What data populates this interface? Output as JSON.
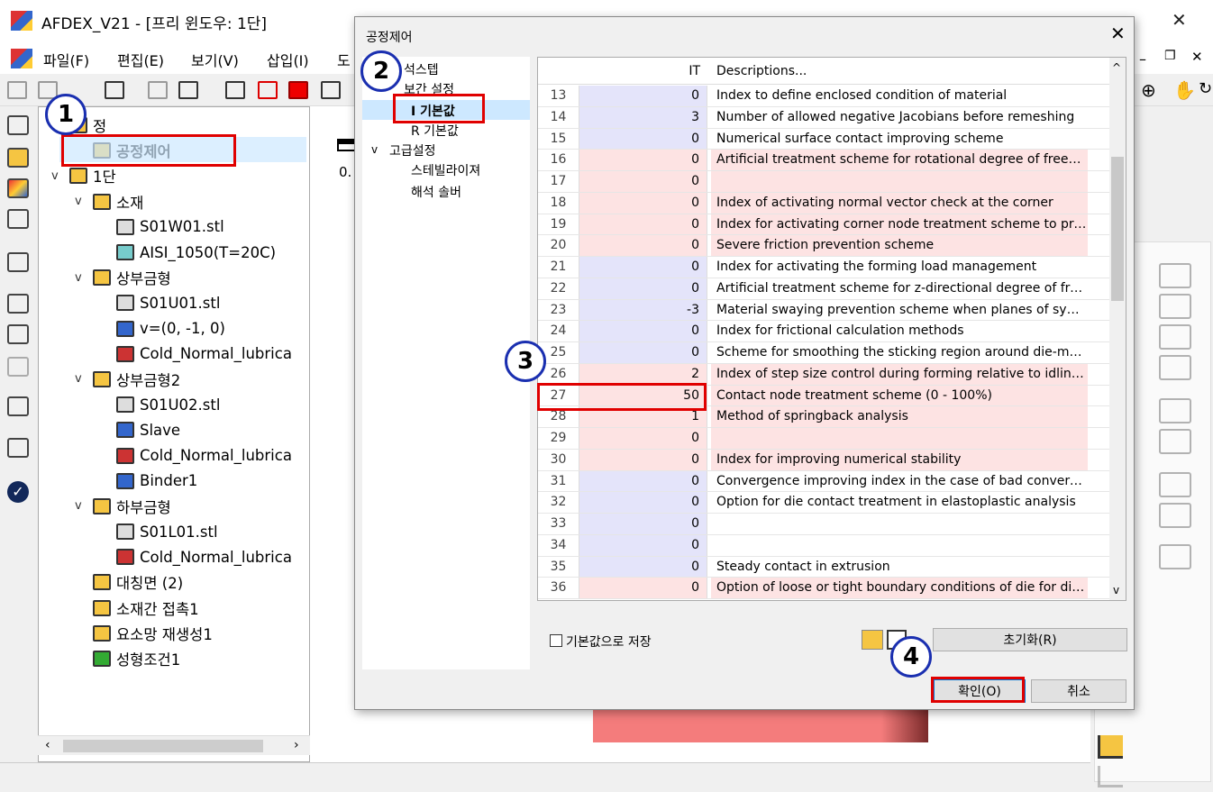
{
  "app": {
    "title": "AFDEX_V21 - [프리 윈도우: 1단]"
  },
  "menus": [
    "파일(F)",
    "편집(E)",
    "보기(V)",
    "삽입(I)",
    "도"
  ],
  "tree": {
    "items": [
      {
        "label": "정",
        "indent": 0,
        "exp": ""
      },
      {
        "label": "공정제어",
        "indent": 1,
        "exp": ""
      },
      {
        "label": "1단",
        "indent": 0,
        "exp": "v"
      },
      {
        "label": "소재",
        "indent": 1,
        "exp": "v"
      },
      {
        "label": "S01W01.stl",
        "indent": 2,
        "exp": ""
      },
      {
        "label": "AISI_1050(T=20C)",
        "indent": 2,
        "exp": ""
      },
      {
        "label": "상부금형",
        "indent": 1,
        "exp": "v"
      },
      {
        "label": "S01U01.stl",
        "indent": 2,
        "exp": ""
      },
      {
        "label": "v=(0, -1, 0)",
        "indent": 2,
        "exp": ""
      },
      {
        "label": "Cold_Normal_lubrica",
        "indent": 2,
        "exp": ""
      },
      {
        "label": "상부금형2",
        "indent": 1,
        "exp": "v"
      },
      {
        "label": "S01U02.stl",
        "indent": 2,
        "exp": ""
      },
      {
        "label": "Slave",
        "indent": 2,
        "exp": ""
      },
      {
        "label": "Cold_Normal_lubrica",
        "indent": 2,
        "exp": ""
      },
      {
        "label": "Binder1",
        "indent": 2,
        "exp": ""
      },
      {
        "label": "하부금형",
        "indent": 1,
        "exp": "v"
      },
      {
        "label": "S01L01.stl",
        "indent": 2,
        "exp": ""
      },
      {
        "label": "Cold_Normal_lubrica",
        "indent": 2,
        "exp": ""
      },
      {
        "label": "대칭면 (2)",
        "indent": 1,
        "exp": ""
      },
      {
        "label": "소재간 접촉1",
        "indent": 1,
        "exp": ""
      },
      {
        "label": "요소망 재생성1",
        "indent": 1,
        "exp": ""
      },
      {
        "label": "성형조건1",
        "indent": 1,
        "exp": ""
      }
    ]
  },
  "viewport": {
    "value_label": "0."
  },
  "dialog": {
    "title": "공정제어",
    "nav": {
      "item1": "석스텝",
      "item2": "보간 설정",
      "item3": "I 기본값",
      "item4": "R 기본값",
      "item5": "고급설정",
      "item6": "스테빌라이져",
      "item7": "해석 솔버"
    },
    "grid": {
      "header": {
        "it": "IT",
        "desc": "Descriptions..."
      },
      "rows": [
        {
          "no": "13",
          "it": "0",
          "desc": "Index to define enclosed condition of material",
          "tone": "blue"
        },
        {
          "no": "14",
          "it": "3",
          "desc": "Number of allowed negative Jacobians before remeshing",
          "tone": "blue"
        },
        {
          "no": "15",
          "it": "0",
          "desc": "Numerical surface contact improving scheme",
          "tone": "blue"
        },
        {
          "no": "16",
          "it": "0",
          "desc": "Artificial treatment scheme for rotational degree of freedom",
          "tone": "pink"
        },
        {
          "no": "17",
          "it": "0",
          "desc": "",
          "tone": "pink"
        },
        {
          "no": "18",
          "it": "0",
          "desc": "Index of activating normal vector check at the corner",
          "tone": "pink"
        },
        {
          "no": "19",
          "it": "0",
          "desc": "Index for activating corner node treatment scheme to prev...",
          "tone": "pink"
        },
        {
          "no": "20",
          "it": "0",
          "desc": "Severe friction prevention scheme",
          "tone": "pink"
        },
        {
          "no": "21",
          "it": "0",
          "desc": "Index for activating the forming load management",
          "tone": "blue"
        },
        {
          "no": "22",
          "it": "0",
          "desc": "Artificial treatment scheme for z-directional degree of freed...",
          "tone": "blue"
        },
        {
          "no": "23",
          "it": "-3",
          "desc": "Material swaying prevention scheme when planes of symm...",
          "tone": "blue"
        },
        {
          "no": "24",
          "it": "0",
          "desc": "Index for frictional calculation methods",
          "tone": "blue"
        },
        {
          "no": "25",
          "it": "0",
          "desc": "Scheme for smoothing the sticking region around die-mat...",
          "tone": "blue"
        },
        {
          "no": "26",
          "it": "2",
          "desc": "Index of step size control during forming relative to idling i...",
          "tone": "pink"
        },
        {
          "no": "27",
          "it": "50",
          "desc": "Contact node treatment scheme (0 - 100%)",
          "tone": "pink"
        },
        {
          "no": "28",
          "it": "1",
          "desc": "Method of springback analysis",
          "tone": "pink"
        },
        {
          "no": "29",
          "it": "0",
          "desc": "",
          "tone": "pink"
        },
        {
          "no": "30",
          "it": "0",
          "desc": "Index for improving numerical stability",
          "tone": "pink"
        },
        {
          "no": "31",
          "it": "0",
          "desc": "Convergence improving index in the case of bad converge...",
          "tone": "blue"
        },
        {
          "no": "32",
          "it": "0",
          "desc": "Option for die contact treatment in elastoplastic analysis",
          "tone": "blue"
        },
        {
          "no": "33",
          "it": "0",
          "desc": "",
          "tone": "blue"
        },
        {
          "no": "34",
          "it": "0",
          "desc": "",
          "tone": "blue"
        },
        {
          "no": "35",
          "it": "0",
          "desc": "Steady contact in extrusion",
          "tone": "blue"
        },
        {
          "no": "36",
          "it": "0",
          "desc": "Option of loose or tight boundary conditions of die for die ...",
          "tone": "pink"
        }
      ]
    },
    "save_default_label": "기본값으로 저장",
    "reset_label": "초기화(R)",
    "ok_label": "확인(O)",
    "cancel_label": "취소"
  },
  "badges": {
    "b1": "1",
    "b2": "2",
    "b3": "3",
    "b4": "4"
  },
  "colors": {
    "highlight_red": "#e00000",
    "badge_blue": "#1a2fb0",
    "row_blue": "#e4e4fa",
    "row_pink": "#fde3e3"
  }
}
